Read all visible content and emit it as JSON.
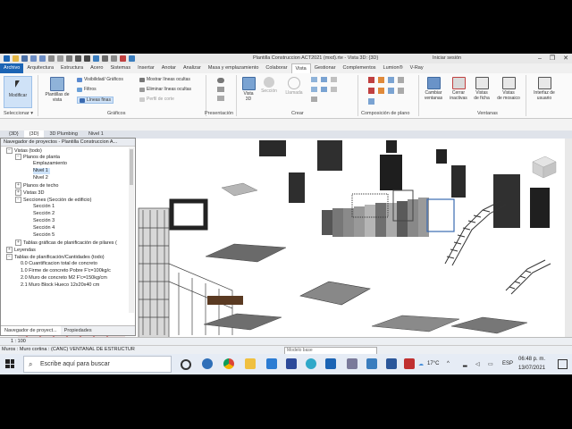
{
  "window": {
    "title": "Plantilla Construccion ACT2021 (mxd).rte - Vista 3D: {3D}",
    "user": "Iniciar sesión",
    "controls": [
      "–",
      "❐",
      "✕"
    ]
  },
  "menu_tabs": [
    "Archivo",
    "Arquitectura",
    "Estructura",
    "Acero",
    "Sistemas",
    "Insertar",
    "Anotar",
    "Analizar",
    "Masa y emplazamiento",
    "Colaborar",
    "Vista",
    "Gestionar",
    "Complementos",
    "Lumion®",
    "V-Ray"
  ],
  "active_tab": "Vista",
  "ribbon": {
    "modify": "Modificar",
    "select_label": "Seleccionar ▾",
    "view_template": "Plantillas de\nvista",
    "vis_graphics": "Visibilidad/ Gráficos",
    "filters": "Filtros",
    "thin_lines": "Líneas finas",
    "show_hidden": "Mostrar líneas ocultas",
    "remove_hidden": "Eliminar líneas ocultas",
    "cut_profile": "Perfil de corte",
    "graphics_label": "Gráficos",
    "presentation_label": "Presentación",
    "view3d": "Vista\n3D",
    "section": "Sección",
    "callout": "Llamada",
    "create_label": "Crear",
    "sheet_comp_label": "Composición de plano",
    "switch_windows": "Cambiar\nventanas",
    "close_inactive": "Cerrar\ninactivas",
    "tab_views": "Vistas\nde ficha",
    "tile_views": "Vistas\nde mosaico",
    "ui": "Interfaz de\nusuario",
    "windows_label": "Ventanas"
  },
  "view_tabs": [
    {
      "label": "{3D}",
      "active": false
    },
    {
      "label": "{3D}",
      "active": true
    },
    {
      "label": "3D Plumbing",
      "active": false
    },
    {
      "label": "Nivel 1",
      "active": false
    }
  ],
  "browser": {
    "title": "Navegador de proyectos - Plantilla Construccion A...",
    "rows": [
      {
        "label": "Vistas (todo)",
        "indent": 0,
        "pm": "−"
      },
      {
        "label": "Planos de planta",
        "indent": 1,
        "pm": "−"
      },
      {
        "label": "Emplazamiento",
        "indent": 2,
        "pm": ""
      },
      {
        "label": "Nivel 1",
        "indent": 2,
        "pm": "",
        "sel": true
      },
      {
        "label": "Nivel 2",
        "indent": 2,
        "pm": ""
      },
      {
        "label": "Planos de techo",
        "indent": 1,
        "pm": "+"
      },
      {
        "label": "Vistas 3D",
        "indent": 1,
        "pm": "+"
      },
      {
        "label": "Secciones (Sección de edificio)",
        "indent": 1,
        "pm": "−"
      },
      {
        "label": "Sección 1",
        "indent": 2,
        "pm": ""
      },
      {
        "label": "Sección 2",
        "indent": 2,
        "pm": ""
      },
      {
        "label": "Sección 3",
        "indent": 2,
        "pm": ""
      },
      {
        "label": "Sección 4",
        "indent": 2,
        "pm": ""
      },
      {
        "label": "Sección 5",
        "indent": 2,
        "pm": ""
      },
      {
        "label": "Tablas gráficas de planificación de pilares (",
        "indent": 1,
        "pm": "+"
      },
      {
        "label": "Leyendas",
        "indent": 0,
        "pm": "+"
      },
      {
        "label": "Tablas de planificación/Cantidades (todo)",
        "indent": 0,
        "pm": "−"
      },
      {
        "label": "0.0 Cuantificacion total de concreto",
        "indent": 1,
        "pm": ""
      },
      {
        "label": "1.0 Firme de concreto Pobre F'c=100kg/c",
        "indent": 1,
        "pm": ""
      },
      {
        "label": "2.0 Muro de concreto M2   F'c=150kg/cm",
        "indent": 1,
        "pm": ""
      },
      {
        "label": "2.1 Muro Block Hueco 12x20x40 cm",
        "indent": 1,
        "pm": ""
      }
    ],
    "tabs": [
      "Navegador de proyect...",
      "Propiedades"
    ]
  },
  "scale": "1 : 100",
  "status": {
    "left": "Muros : Muro cortina : (CANC) VENTANAL DE ESTRUCTUR",
    "model": "Modelo base"
  },
  "taskbar": {
    "search_placeholder": "Escribe aquí para buscar",
    "weather": "17°C",
    "lang": "ESP",
    "time": "06:48 p. m.",
    "date": "13/07/2021"
  },
  "colors": {
    "file_tab": "#1b64b4",
    "selection": "#cde3fa",
    "accent": "#2b579a"
  }
}
